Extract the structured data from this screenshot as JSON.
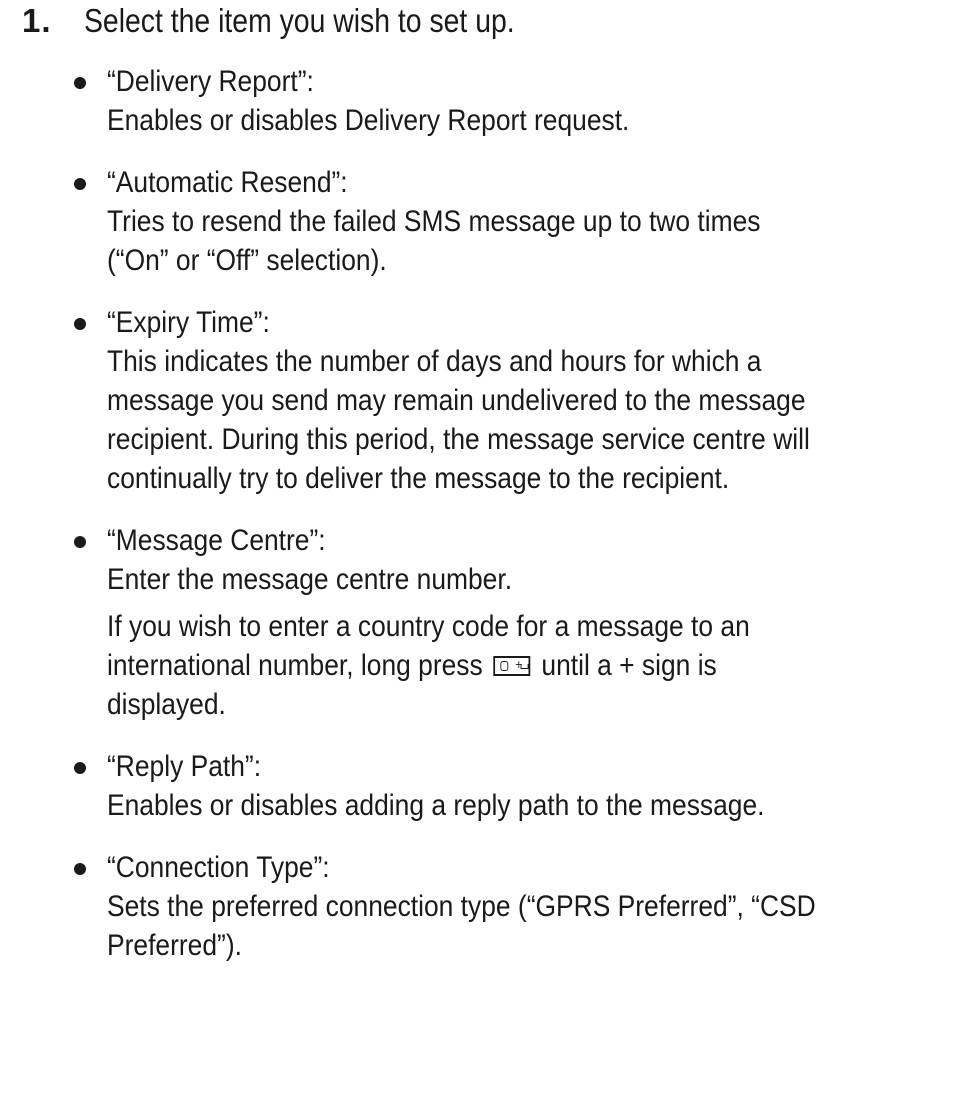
{
  "step": {
    "number": "1.",
    "text": "Select the item you wish to set up."
  },
  "items": [
    {
      "title": "“Delivery Report”:",
      "lines": [
        "Enables or disables Delivery Report request."
      ]
    },
    {
      "title": "“Automatic Resend”:",
      "lines": [
        "Tries to resend the failed SMS message up to two times",
        "(“On” or “Off” selection)."
      ]
    },
    {
      "title": "“Expiry Time”:",
      "lines": [
        "This indicates the number of days and hours for which a",
        "message you send may remain undelivered to the message",
        "recipient. During this period, the message service centre will",
        "continually try to deliver the message to the recipient."
      ]
    },
    {
      "title": "“Message Centre”:",
      "lines": [
        "Enter the message centre number."
      ],
      "extra": {
        "line1": "If you wish to enter a country code for a message to an",
        "line2_before": "international number, long press",
        "key_icon": "zero-plus-space-key-icon",
        "line2_after": "until a + sign is",
        "line3": "displayed."
      }
    },
    {
      "title": "“Reply Path”:",
      "lines": [
        "Enables or disables adding a reply path to the message."
      ]
    },
    {
      "title": "“Connection Type”:",
      "lines": [
        "Sets the preferred connection type (“GPRS Preferred”, “CSD",
        "Preferred”)."
      ]
    }
  ]
}
